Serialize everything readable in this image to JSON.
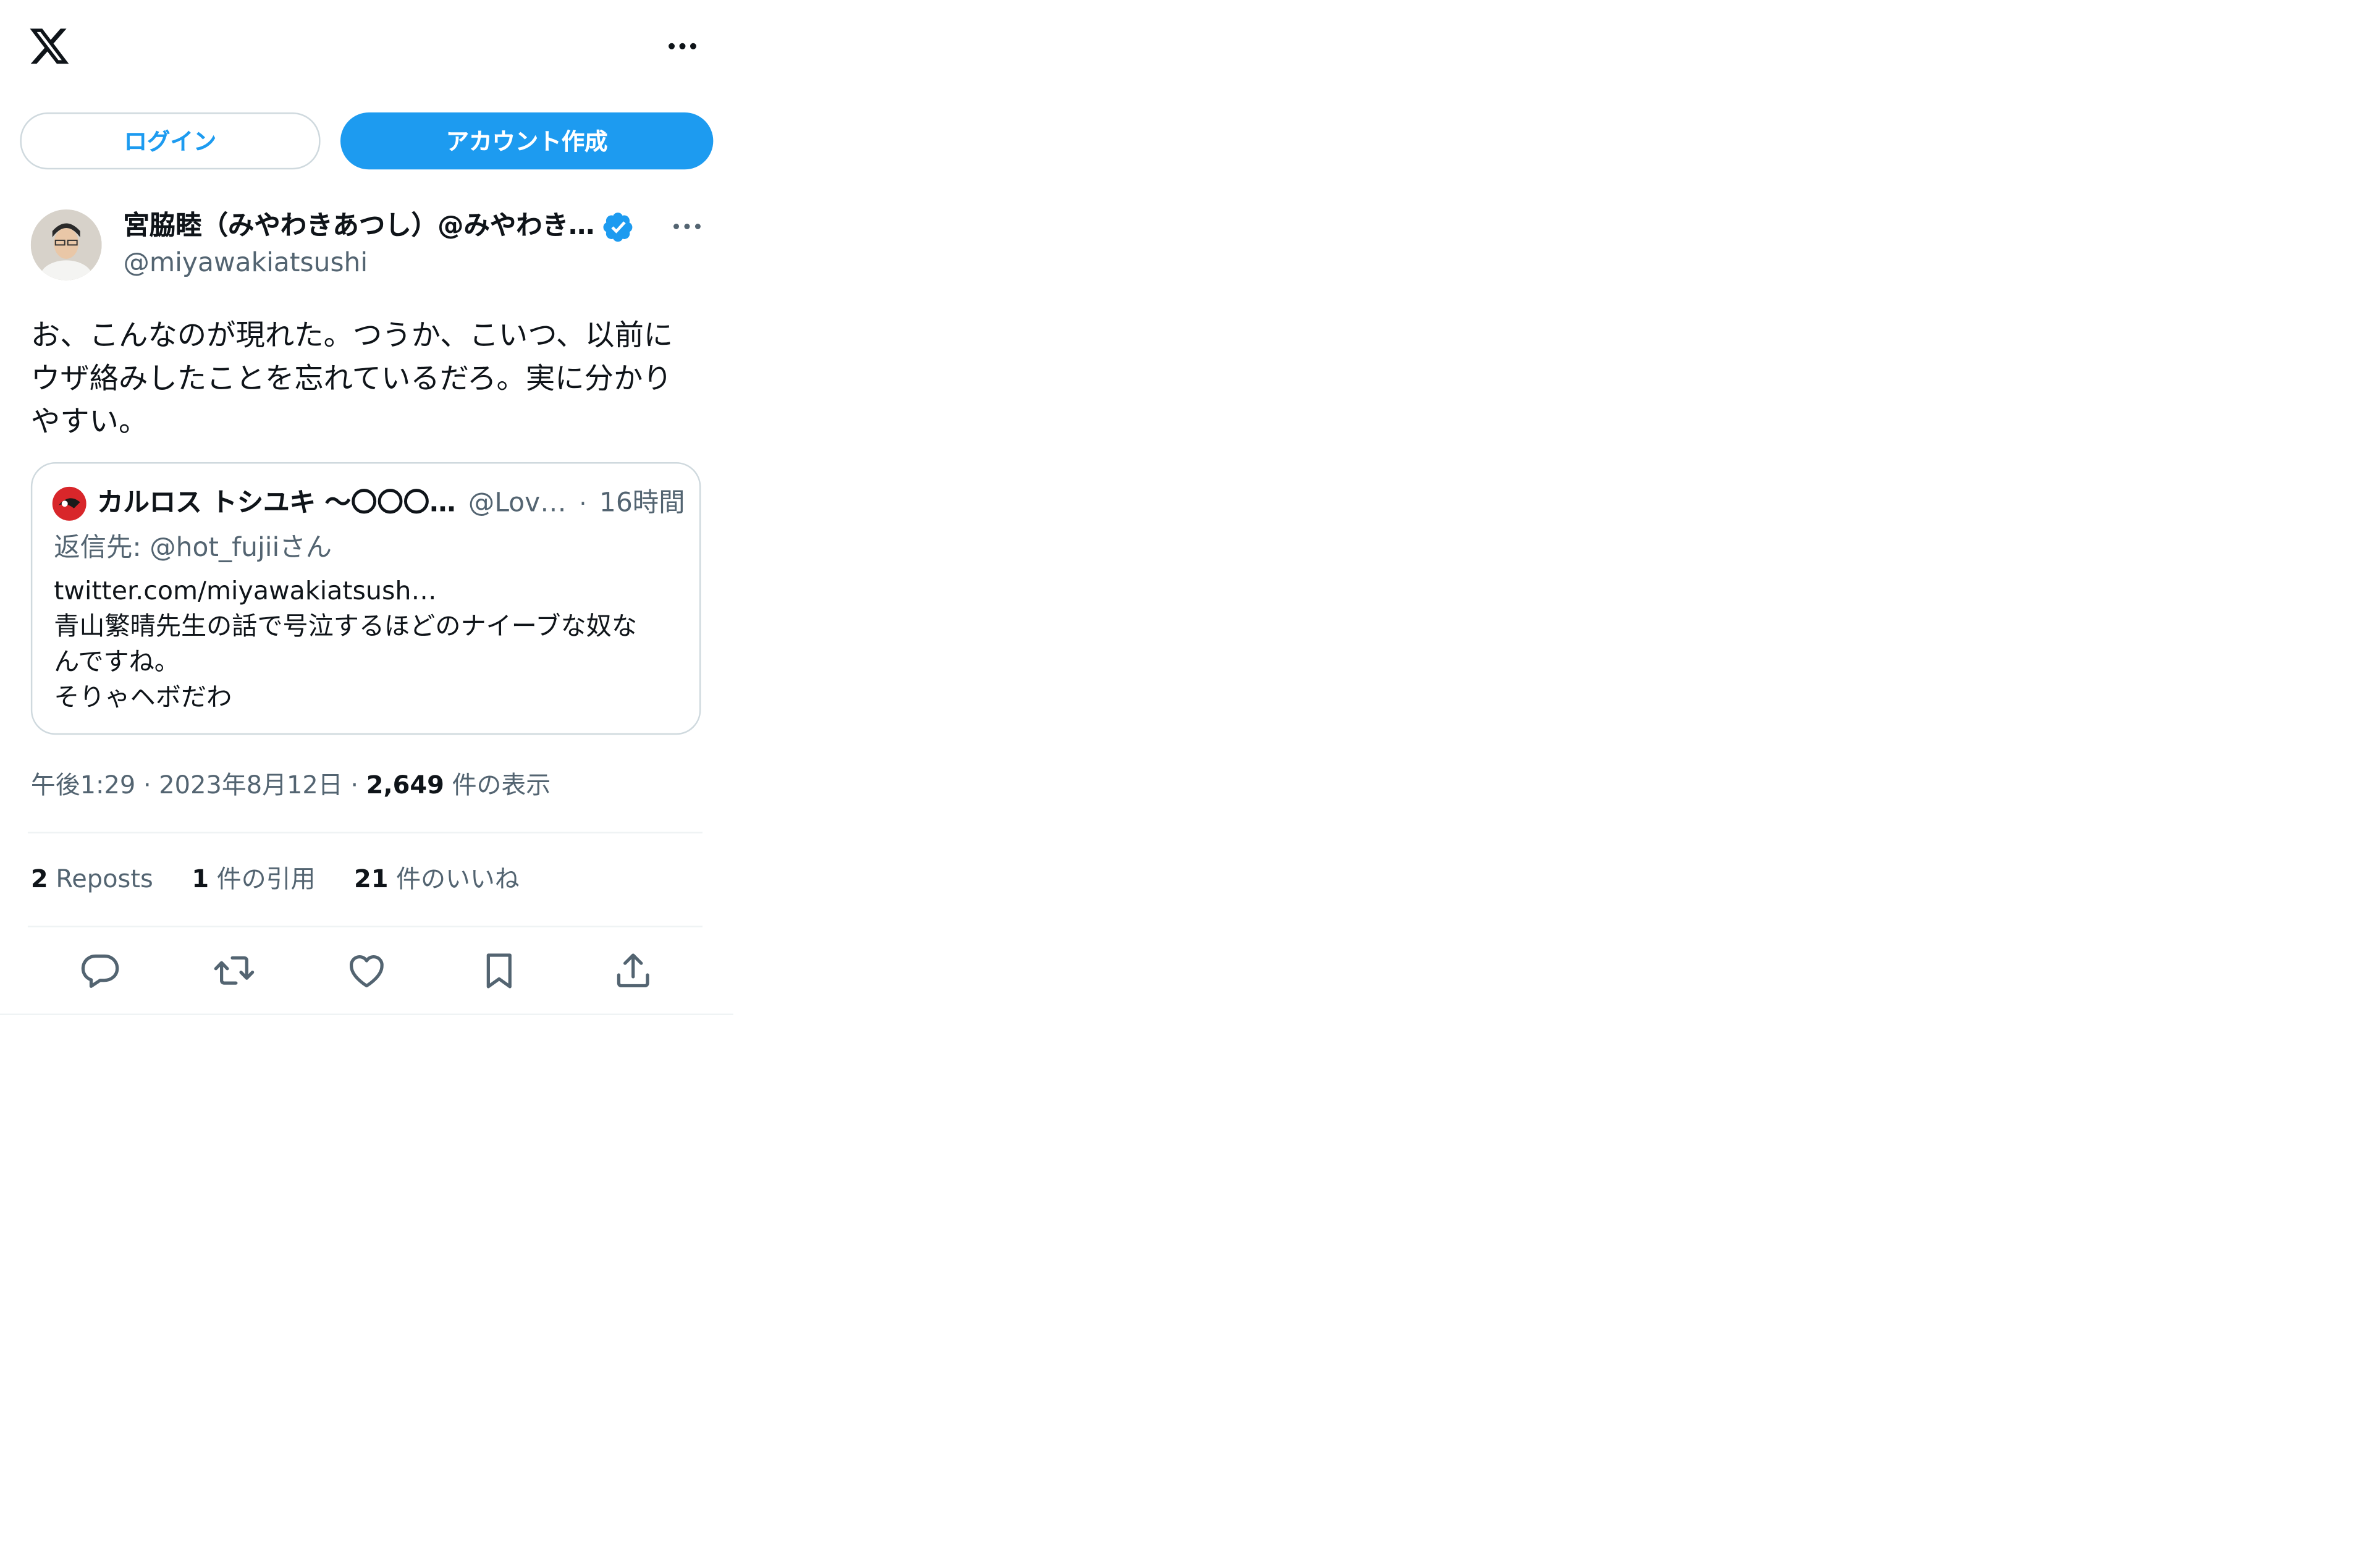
{
  "header": {
    "logo_icon": "x-logo-icon",
    "more_icon": "more-horizontal-icon"
  },
  "auth": {
    "login_label": "ログイン",
    "signup_label": "アカウント作成"
  },
  "tweet": {
    "author_name": "宮脇睦（みやわきあつし）@みやわき…",
    "verified_icon": "verified-badge-icon",
    "handle": "@miyawakiatsushi",
    "text": "お、こんなのが現れた。つうか、こいつ、以前に\nウザ絡みしたことを忘れているだろ。実に分かり\nやすい。",
    "time": "午後1:29",
    "date": "2023年8月12日",
    "views_count": "2,649",
    "views_label": "件の表示"
  },
  "quote": {
    "author_name": "カルロス トシユキ 〜〇〇〇…",
    "handle": "@Lov…",
    "separator": "·",
    "time": "16時間",
    "reply_prefix": "返信先: ",
    "reply_to": "@hot_fujiiさん",
    "text": "twitter.com/miyawakiatsush…\n青山繁晴先生の話で号泣するほどのナイーブな奴な\nんですね。\nそりゃヘボだわ"
  },
  "stats": {
    "reposts_count": "2",
    "reposts_label": "Reposts",
    "quotes_count": "1",
    "quotes_label": "件の引用",
    "likes_count": "21",
    "likes_label": "件のいいね"
  },
  "actions": [
    "reply-icon",
    "retweet-icon",
    "like-icon",
    "bookmark-icon",
    "share-icon"
  ],
  "colors": {
    "accent": "#1d9bf0",
    "text": "#0f1419",
    "secondary": "#536471",
    "border": "#cfd9de"
  }
}
